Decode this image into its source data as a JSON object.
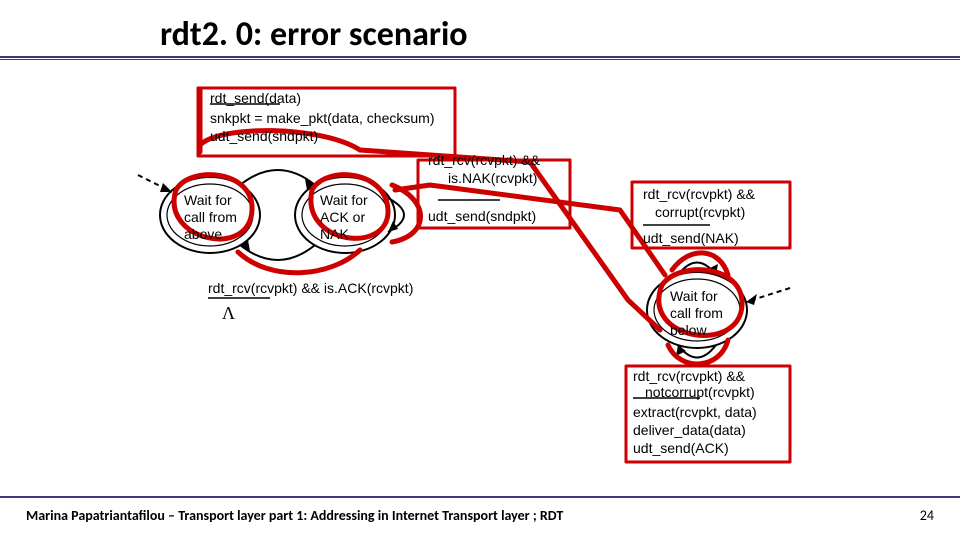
{
  "title": "rdt2. 0: error scenario",
  "footer": "Marina Papatriantafilou –  Transport layer part 1: Addressing in Internet Transport layer ; RDT",
  "page": "24",
  "sender": {
    "state_above": "Wait for\ncall from\nabove",
    "state_ack": "Wait for\nACK or\nNAK",
    "send": {
      "event": "rdt_send(data)",
      "a1": "snkpkt = make_pkt(data, checksum)",
      "a2": "udt_send(sndpkt)"
    },
    "nak": {
      "cond1": "rdt_rcv(rcvpkt) &&",
      "cond2": "is.NAK(rcvpkt)",
      "act": "udt_send(sndpkt)"
    },
    "ack": {
      "cond": "rdt_rcv(rcvpkt) && is.ACK(rcvpkt)",
      "lambda": "Λ"
    }
  },
  "receiver": {
    "state_below": "Wait for\ncall from\nbelow",
    "corrupt": {
      "c1": "rdt_rcv(rcvpkt) &&",
      "c2": "corrupt(rcvpkt)",
      "act": "udt_send(NAK)"
    },
    "ok": {
      "c1": "rdt_rcv(rcvpkt) &&",
      "c2": "notcorrupt(rcvpkt)",
      "a1": "extract(rcvpkt, data)",
      "a2": "deliver_data(data)",
      "a3": "udt_send(ACK)"
    }
  }
}
